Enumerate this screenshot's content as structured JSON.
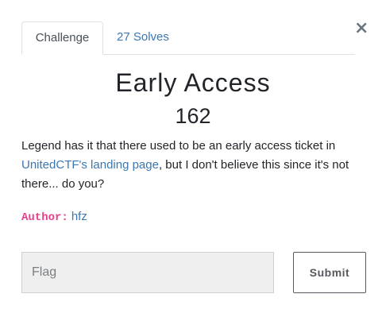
{
  "tabs": [
    {
      "label": "Challenge",
      "active": true
    },
    {
      "label": "27 Solves",
      "active": false
    }
  ],
  "close_icon": "×",
  "challenge": {
    "name": "Early Access",
    "value": "162",
    "description": {
      "before": "Legend has it that there used to be an early access ticket in ",
      "link_text": "UnitedCTF's landing page",
      "after": ", but I don't believe this since it's not there... do you?"
    },
    "author_label": "Author:",
    "author_name": "hfz"
  },
  "form": {
    "flag_placeholder": "Flag",
    "flag_value": "",
    "submit_label": "Submit"
  },
  "colors": {
    "link": "#3a77b3",
    "author_label": "#e83e8c",
    "input_bg": "#efefef"
  }
}
